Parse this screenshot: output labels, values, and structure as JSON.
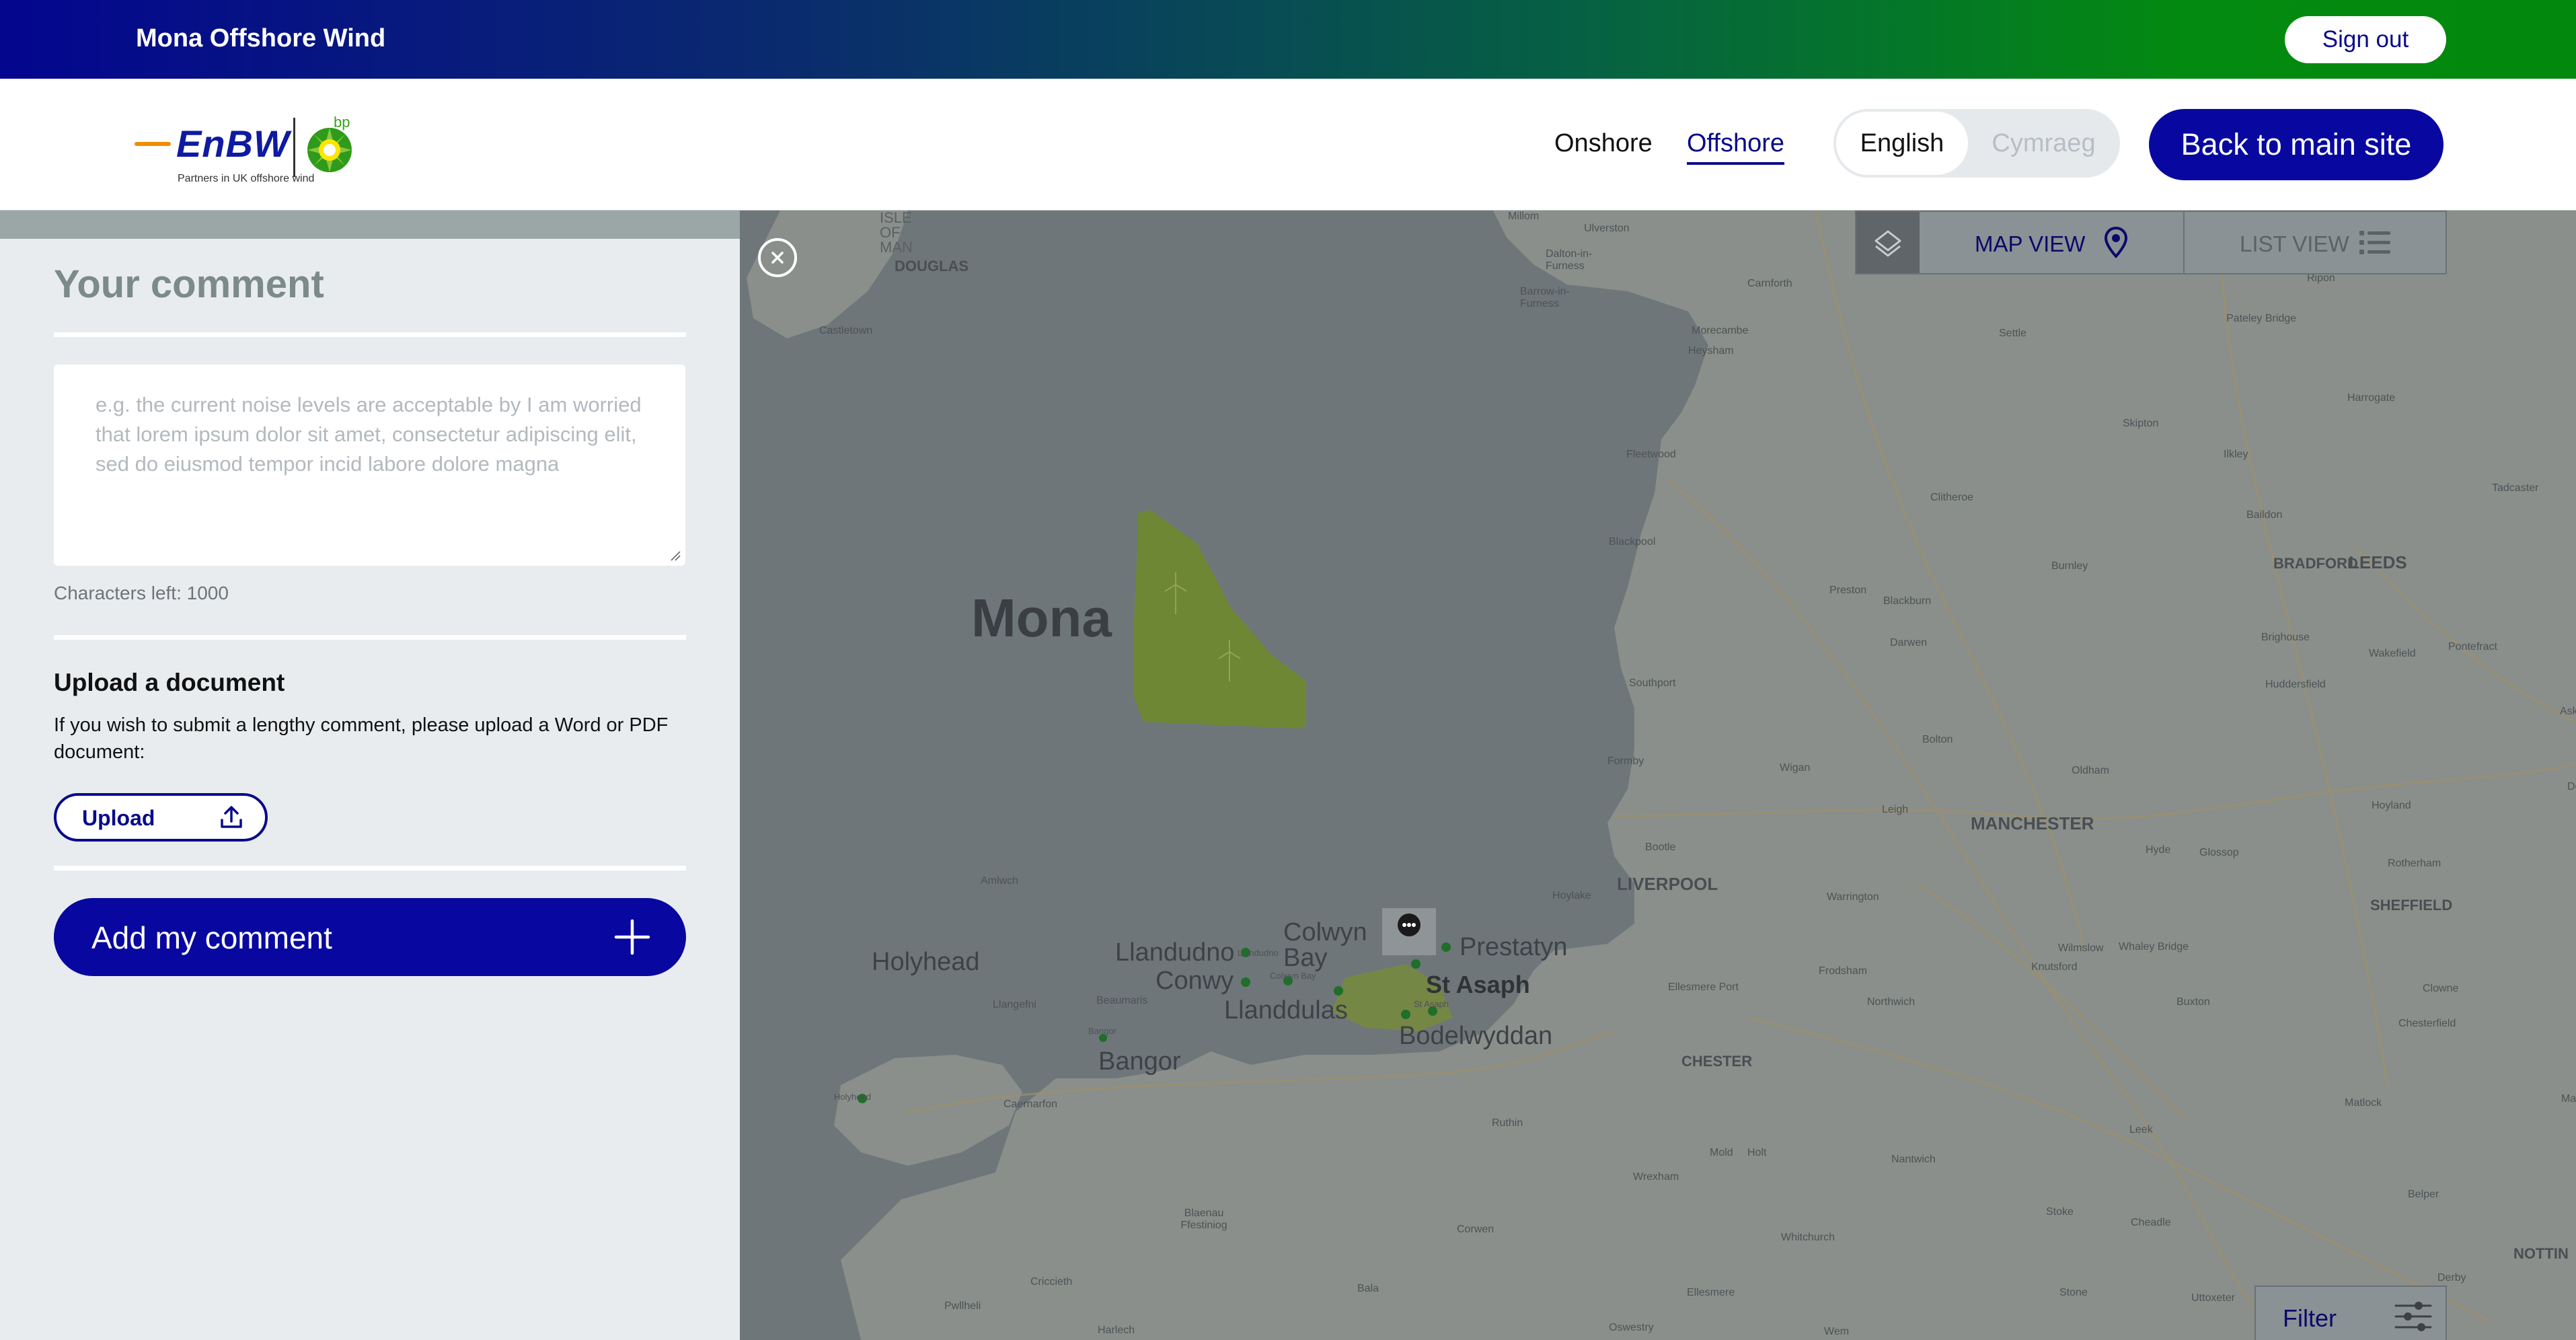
{
  "app": {
    "title": "Mona Offshore Wind",
    "sign_out": "Sign out"
  },
  "header": {
    "logo": {
      "brand": "EnBW",
      "partner": "bp",
      "tagline": "Partners in UK offshore wind"
    },
    "nav": {
      "onshore": "Onshore",
      "offshore": "Offshore"
    },
    "language": {
      "english": "English",
      "welsh": "Cymraeg",
      "selected": "English"
    },
    "back_button": "Back to main site"
  },
  "panel": {
    "heading": "Your comment",
    "comment_placeholder": "e.g. the current noise levels are acceptable by I am worried that lorem ipsum dolor sit amet, consectetur adipiscing elit, sed do eiusmod tempor incid labore dolore magna",
    "chars_left": "Characters left: 1000",
    "upload_title": "Upload a document",
    "upload_desc": "If you wish to submit a lengthy comment, please upload a Word or PDF document:",
    "upload_button": "Upload",
    "add_button": "Add my comment"
  },
  "map": {
    "map_view": "MAP VIEW",
    "list_view": "LIST VIEW",
    "filter": "Filter",
    "site_label": "Mona",
    "colors": {
      "site": "#6e8a2e",
      "land": "#8a8f8b",
      "sea": "#6e767a",
      "accent": "#0808a0"
    },
    "places_large": [
      "Holyhead",
      "Llandudno",
      "Colwyn Bay",
      "Conwy",
      "Llanddulas",
      "Prestatyn",
      "St Asaph",
      "Bodelwyddan",
      "Bangor"
    ],
    "places_medium": [
      "LIVERPOOL",
      "MANCHESTER",
      "BRADFORD",
      "LEEDS",
      "SHEFFIELD",
      "CHESTER",
      "DOUGLAS",
      "NOTTIN"
    ],
    "places_small": [
      "ISLE OF MAN",
      "Castletown",
      "Millom",
      "Ulverston",
      "Dalton-in-Furness",
      "Barrow-in-Furness",
      "Carnforth",
      "Morecambe",
      "Heysham",
      "Settle",
      "Ripon",
      "Pateley Bridge",
      "Harrogate",
      "Skipton",
      "Ilkley",
      "Tadcaster",
      "Fleetwood",
      "Clitheroe",
      "Blackpool",
      "Baildon",
      "Burnley",
      "Preston",
      "Blackburn",
      "Darwen",
      "Brighouse",
      "Pontefract",
      "Southport",
      "Wakefield",
      "Huddersfield",
      "Aske",
      "Bolton",
      "Formby",
      "Wigan",
      "Oldham",
      "Leigh",
      "Hoyland",
      "Donc",
      "Bootle",
      "Hyde",
      "Glossop",
      "Rotherham",
      "Amlwch",
      "Hoylake",
      "Warrington",
      "Wilmslow",
      "Whaley Bridge",
      "Knutsford",
      "Frodsham",
      "Ellesmere Port",
      "Northwich",
      "Buxton",
      "Clowne",
      "Chesterfield",
      "Llangefni",
      "Beaumaris",
      "Caernarfon",
      "Ruthin",
      "Mold",
      "Holt",
      "Leek",
      "Matlock",
      "Mansfield",
      "Wrexham",
      "Nantwich",
      "Stoke",
      "Cheadle",
      "Belper",
      "Blaenau Ffestiniog",
      "Corwen",
      "Whitchurch",
      "Criccieth",
      "Bala",
      "Ellesmere",
      "Stone",
      "Uttoxeter",
      "Derby",
      "Pwllheli",
      "Harlech",
      "Oswestry",
      "Wem",
      "Llandudno",
      "Colwyn Bay",
      "St Asaph",
      "Bangor",
      "Holyhead"
    ]
  }
}
